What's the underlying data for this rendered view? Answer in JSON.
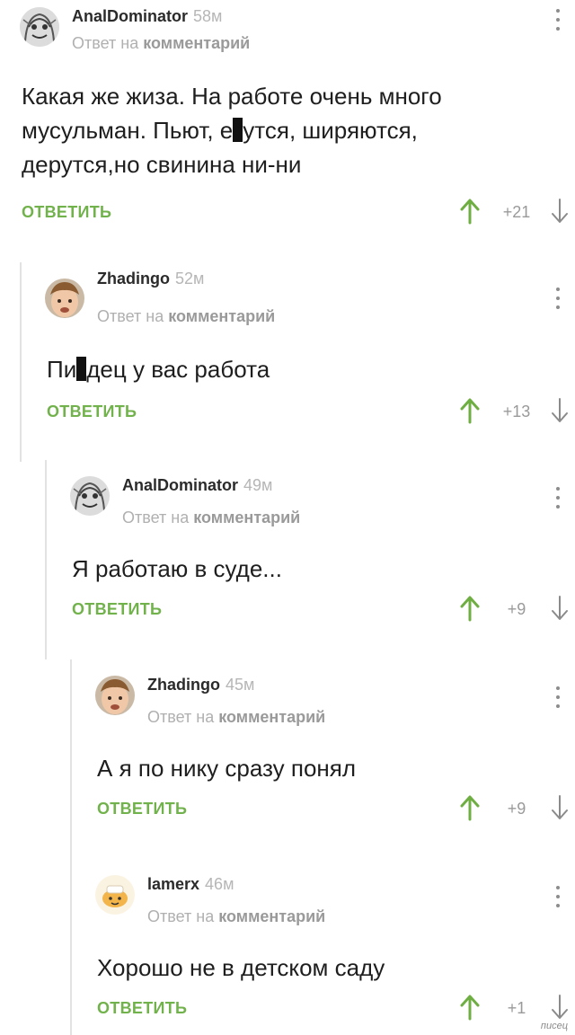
{
  "colors": {
    "accent_green": "#72b24c",
    "upvote_green": "#6fae42",
    "muted": "#b0b0b0",
    "thread_line": "#e2e2e2"
  },
  "icons": {
    "upvote": "arrow-up-icon",
    "downvote": "arrow-down-icon",
    "menu": "more-vertical-icon"
  },
  "comments": [
    {
      "author": "AnalDominator",
      "time": "58м",
      "reply_prefix": "Ответ на",
      "reply_target": "комментарий",
      "text_parts": [
        "Какая же жиза. На работе очень много мусульман. Пьют, е",
        "утся, ширяются, дерутся,но свинина ни-ни"
      ],
      "reply_label": "ОТВЕТИТЬ",
      "score": "+21"
    },
    {
      "author": "Zhadingo",
      "time": "52м",
      "reply_prefix": "Ответ на",
      "reply_target": "комментарий",
      "text_parts": [
        "Пи",
        "дец у вас работа"
      ],
      "reply_label": "ОТВЕТИТЬ",
      "score": "+13"
    },
    {
      "author": "AnalDominator",
      "time": "49м",
      "reply_prefix": "Ответ на",
      "reply_target": "комментарий",
      "text": "Я работаю в суде...",
      "reply_label": "ОТВЕТИТЬ",
      "score": "+9"
    },
    {
      "author": "Zhadingo",
      "time": "45м",
      "reply_prefix": "Ответ на",
      "reply_target": "комментарий",
      "text": "А я по нику сразу понял",
      "reply_label": "ОТВЕТИТЬ",
      "score": "+9"
    },
    {
      "author": "lamerx",
      "time": "46м",
      "reply_prefix": "Ответ на",
      "reply_target": "комментарий",
      "text": "Хорошо не в детском саду",
      "reply_label": "ОТВЕТИТЬ",
      "score": "+1"
    }
  ],
  "watermark": "писец"
}
